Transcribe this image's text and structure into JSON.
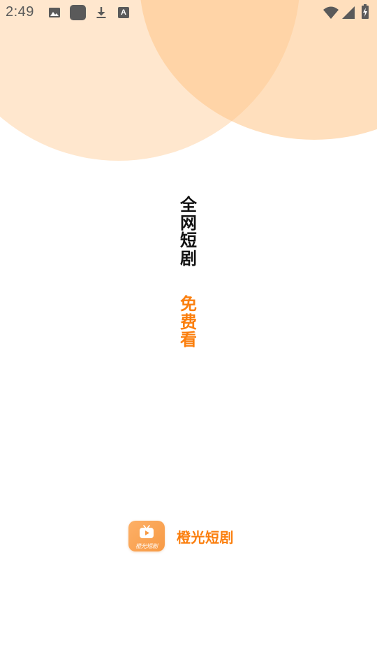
{
  "status_bar": {
    "time": "2:49",
    "icon_color": "#5a5a5a",
    "icons": [
      "image-icon",
      "app-square-icon",
      "download-icon",
      "font-icon",
      "wifi-icon",
      "signal-icon",
      "battery-charging-icon"
    ],
    "font_icon_letter": "A"
  },
  "background": {
    "blob_left_color": "#ffd8b0",
    "blob_right_color": "#ffc487"
  },
  "slogan": {
    "line1": [
      "全",
      "网",
      "短",
      "剧"
    ],
    "line2": [
      "免",
      "费",
      "看"
    ],
    "line1_color": "#111111",
    "line2_color": "#fb7f0e"
  },
  "brand": {
    "name": "橙光短剧",
    "logo_caption": "橙光短剧",
    "logo_icon": "tv-play-icon",
    "accent_color": "#fb7f0e"
  }
}
